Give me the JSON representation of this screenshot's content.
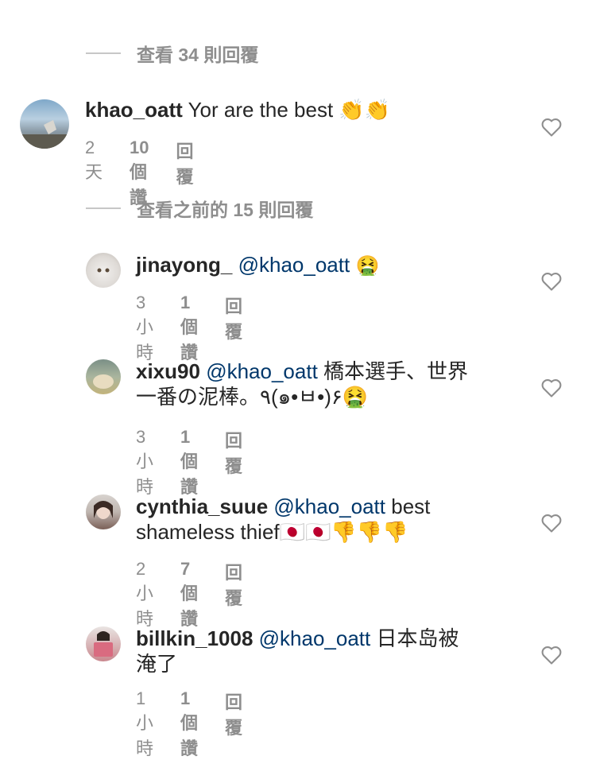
{
  "view_replies_1": "查看 34 則回覆",
  "view_replies_2": "查看之前的 15 則回覆",
  "comments": [
    {
      "username": "khao_oatt",
      "mention": "",
      "text": "Yor are the best 👏👏",
      "time": "2天",
      "likes": "10 個讚",
      "reply": "回覆"
    },
    {
      "username": "jinayong_",
      "mention": "@khao_oatt",
      "text": "🤮",
      "time": "3小時",
      "likes": "1 個讚",
      "reply": "回覆"
    },
    {
      "username": "xixu90",
      "mention": "@khao_oatt",
      "text": "橋本選手、世界",
      "text2": "一番の泥棒。٩(๑•ㅂ•)۶🤮",
      "time": "3小時",
      "likes": "1 個讚",
      "reply": "回覆"
    },
    {
      "username": "cynthia_suue",
      "mention": "@khao_oatt",
      "text": " best",
      "text2": "shameless thief🇯🇵🇯🇵👎👎👎",
      "time": "2小時",
      "likes": "7 個讚",
      "reply": "回覆"
    },
    {
      "username": "billkin_1008",
      "mention": "@khao_oatt",
      "text": "日本岛被",
      "text2": "淹了",
      "time": "1小時",
      "likes": "1 個讚",
      "reply": "回覆"
    }
  ]
}
